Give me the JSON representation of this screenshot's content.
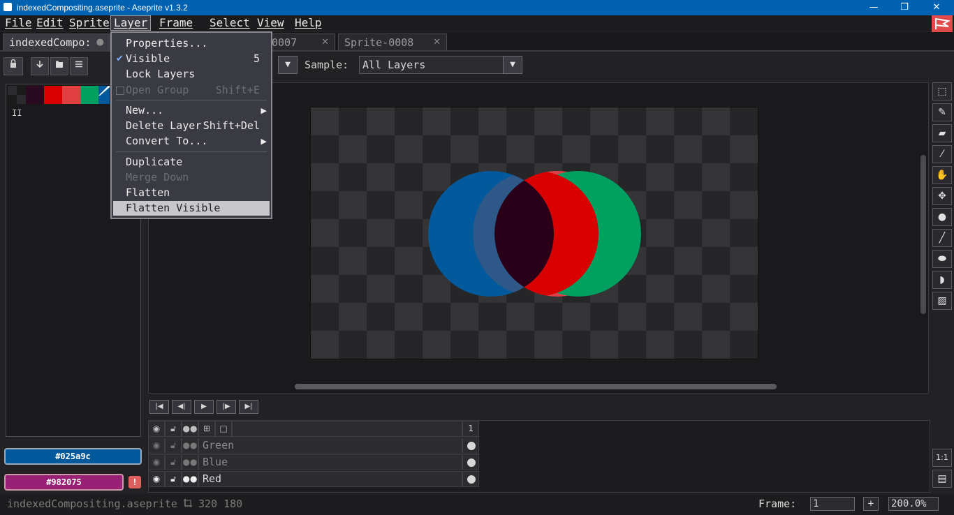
{
  "window": {
    "title": "indexedCompositing.aseprite - Aseprite v1.3.2",
    "minimize": "—",
    "maximize": "❐",
    "close": "✕"
  },
  "menubar": [
    "File",
    "Edit",
    "Sprite",
    "Layer",
    "Frame",
    "Select",
    "View",
    "Help"
  ],
  "tabs": [
    {
      "label": "indexedCompo:",
      "close": "●"
    },
    {
      "label": "0007",
      "close": "✕"
    },
    {
      "label": "Sprite-0008",
      "close": "✕"
    }
  ],
  "layer_menu": {
    "items": [
      {
        "label": "Properties...",
        "shortcut": ""
      },
      {
        "label": "Visible",
        "shortcut": "5",
        "checked": true
      },
      {
        "label": "Lock Layers",
        "shortcut": ""
      },
      {
        "label": "Open Group",
        "shortcut": "Shift+E",
        "disabled": true
      },
      {
        "label": "New...",
        "submenu": true
      },
      {
        "label": "Delete Layer",
        "shortcut": "Shift+Del"
      },
      {
        "label": "Convert To...",
        "submenu": true
      },
      {
        "label": "Duplicate",
        "shortcut": ""
      },
      {
        "label": "Merge Down",
        "shortcut": "",
        "disabled": true
      },
      {
        "label": "Flatten",
        "shortcut": ""
      },
      {
        "label": "Flatten Visible",
        "shortcut": "",
        "selected": true
      }
    ]
  },
  "context_bar": {
    "sample_label": "Sample:",
    "sample_value": "All Layers"
  },
  "palette": {
    "swatches": [
      "#1a1a1d",
      "#2a0a20",
      "#d80000",
      "#e04040",
      "#00a060",
      "#025a9c"
    ],
    "index_marker": "II"
  },
  "colors": {
    "foreground": "#025a9c",
    "background": "#982075",
    "warning": "!"
  },
  "timeline": {
    "frame_header": "1",
    "layers": [
      {
        "name": "Green"
      },
      {
        "name": "Blue"
      },
      {
        "name": "Red"
      }
    ]
  },
  "status": {
    "filename": "indexedCompositing.aseprite",
    "size": "320 180",
    "frame_label": "Frame:",
    "frame_value": "1",
    "add_frame": "+",
    "zoom": "200.0%"
  },
  "sprite_circles": {
    "blue": "#025a9c",
    "red": "#d80000",
    "green": "#00a060",
    "overlap": "#2a0018"
  }
}
